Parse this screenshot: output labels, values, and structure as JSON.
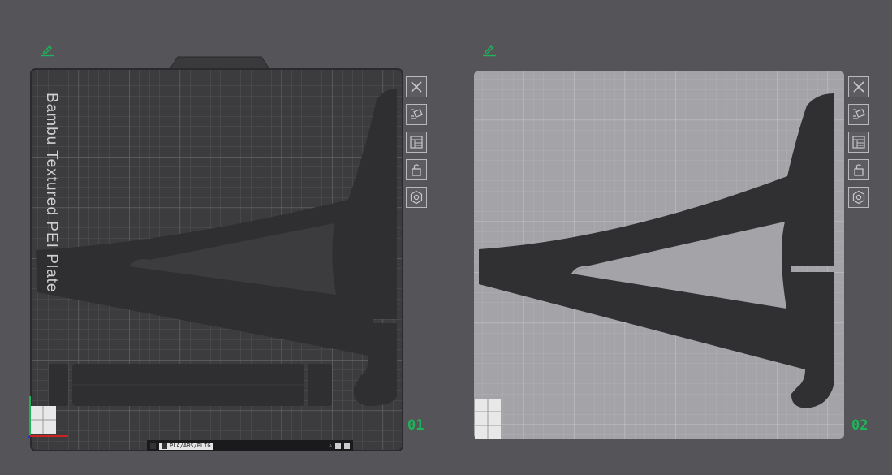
{
  "bed_label": "Bambu Textured PEI Plate",
  "plates": [
    {
      "number": "01",
      "state": "active",
      "toolbar": [
        "close-icon",
        "auto-orient-icon",
        "arrange-icon",
        "lock-icon",
        "settings-icon"
      ]
    },
    {
      "number": "02",
      "state": "inactive",
      "toolbar": [
        "close-icon",
        "auto-orient-icon",
        "arrange-icon",
        "lock-icon",
        "settings-icon"
      ]
    }
  ],
  "status_bar": {
    "filament": "PLA/ABS/PLTG"
  },
  "colors": {
    "background": "#545459",
    "bed_dark": "#3e3e41",
    "bed_light": "#a5a5a9",
    "model": "#2f2f31",
    "accent": "#1fb45a"
  }
}
